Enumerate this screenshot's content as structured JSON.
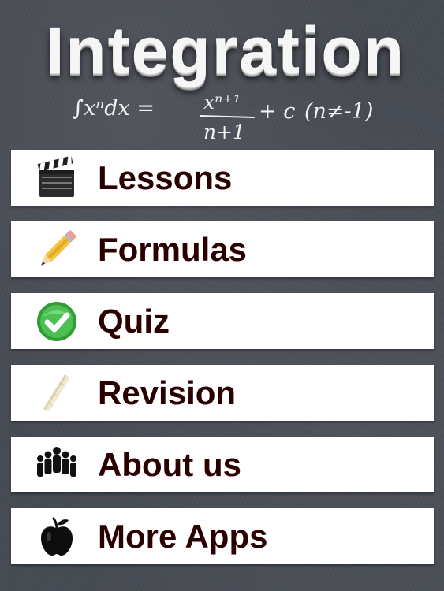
{
  "header": {
    "title": "Integration",
    "formula": {
      "integral_expr": "∫xⁿdx =",
      "numerator": "xⁿ⁺¹",
      "denominator": "n+1",
      "constant": "+ c",
      "condition": "(n≠-1)"
    }
  },
  "menu": {
    "items": [
      {
        "label": "Lessons",
        "icon": "clapperboard-icon"
      },
      {
        "label": "Formulas",
        "icon": "pencil-icon"
      },
      {
        "label": "Quiz",
        "icon": "checkmark-icon"
      },
      {
        "label": "Revision",
        "icon": "chalk-icon"
      },
      {
        "label": "About us",
        "icon": "people-icon"
      },
      {
        "label": "More Apps",
        "icon": "apple-icon"
      }
    ]
  },
  "colors": {
    "background": "#464a52",
    "menu_item_background": "#ffffff",
    "menu_label": "#2a0000",
    "title": "#f6f6f6",
    "chalk": "#f2f2f2",
    "check_green": "#35b43a"
  }
}
